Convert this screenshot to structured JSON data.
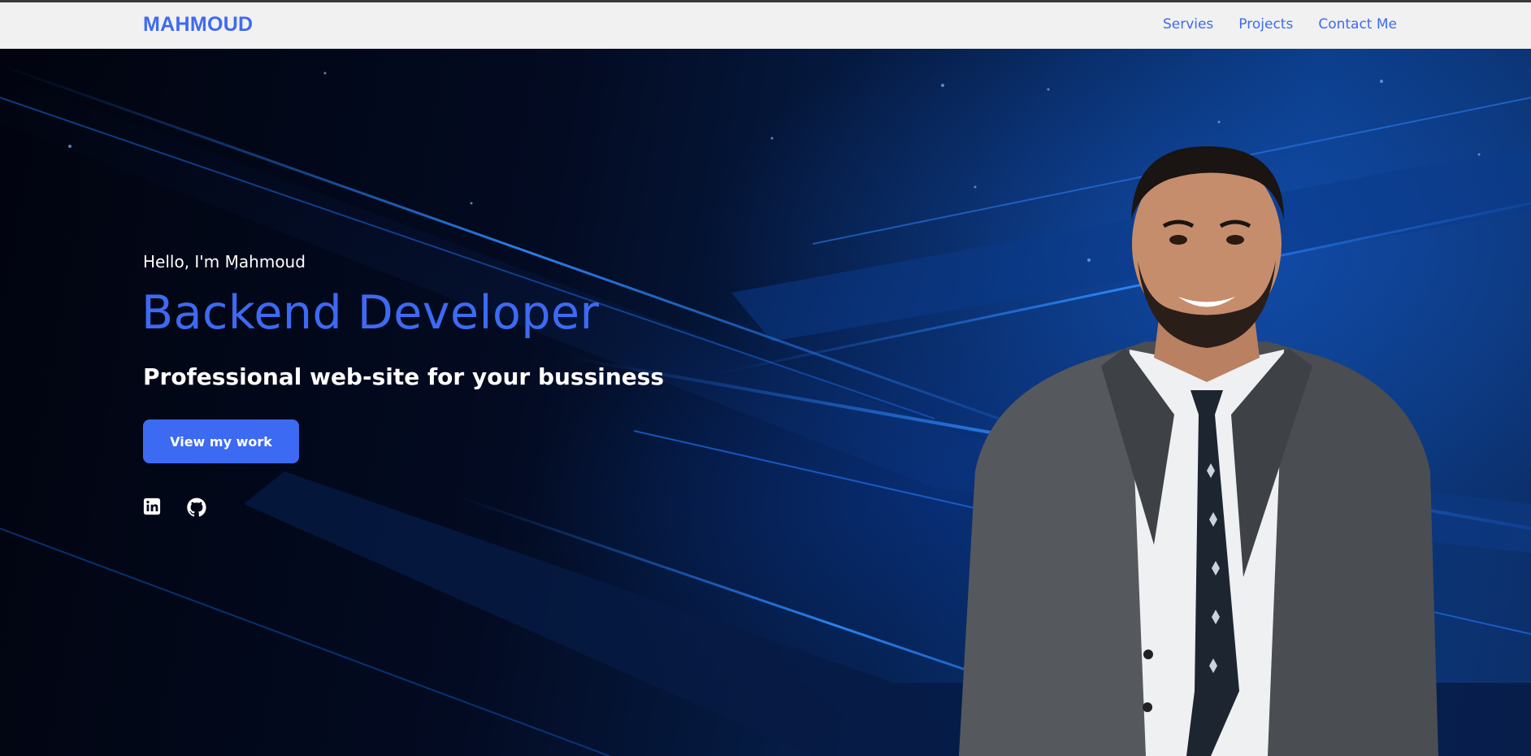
{
  "nav": {
    "logo": "MAHMOUD",
    "links": [
      {
        "label": "Servies"
      },
      {
        "label": "Projects"
      },
      {
        "label": "Contact Me"
      }
    ]
  },
  "hero": {
    "greeting": "Hello, I'm Mahmoud",
    "role": "Backend Developer",
    "tagline": "Professional web-site for your bussiness",
    "cta_label": "View my work",
    "socials": [
      {
        "icon": "linkedin-icon"
      },
      {
        "icon": "github-icon"
      }
    ]
  },
  "colors": {
    "accent": "#3d6af2",
    "navbar_bg": "#f1f1f1",
    "hero_bg": "#020818",
    "text_light": "#ffffff"
  }
}
